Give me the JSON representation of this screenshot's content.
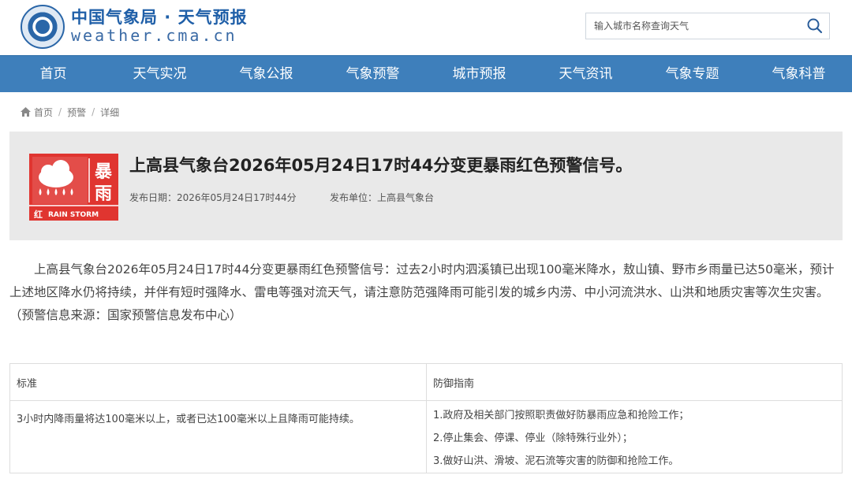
{
  "header": {
    "site_title": "中国气象局 · 天气预报",
    "site_domain": "weather.cma.cn",
    "search_placeholder": "输入城市名称查询天气"
  },
  "nav": [
    "首页",
    "天气实况",
    "气象公报",
    "气象预警",
    "城市预报",
    "天气资讯",
    "气象专题",
    "气象科普"
  ],
  "breadcrumb": [
    "首页",
    "预警",
    "详细"
  ],
  "warning": {
    "title": "上高县气象台2026年05月24日17时44分变更暴雨红色预警信号。",
    "publish_date": "发布日期：2026年05月24日17时44分",
    "publish_unit": "发布单位：上高县气象台",
    "icon_chars": [
      "暴",
      "雨"
    ],
    "icon_level": "红",
    "icon_en": "RAIN STORM",
    "color": "#e03530"
  },
  "content": "上高县气象台2026年05月24日17时44分变更暴雨红色预警信号：过去2小时内泗溪镇已出现100毫米降水，敖山镇、野市乡雨量已达50毫米，预计上述地区降水仍将持续，并伴有短时强降水、雷电等强对流天气，请注意防范强降雨可能引发的城乡内涝、中小河流洪水、山洪和地质灾害等次生灾害。（预警信息来源：国家预警信息发布中心）",
  "table": {
    "headers": [
      "标准",
      "防御指南"
    ],
    "standard": "3小时内降雨量将达100毫米以上，或者已达100毫米以上且降雨可能持续。",
    "guides": [
      "1.政府及相关部门按照职责做好防暴雨应急和抢险工作；",
      "2.停止集会、停课、停业（除特殊行业外）；",
      "3.做好山洪、滑坡、泥石流等灾害的防御和抢险工作。"
    ]
  }
}
